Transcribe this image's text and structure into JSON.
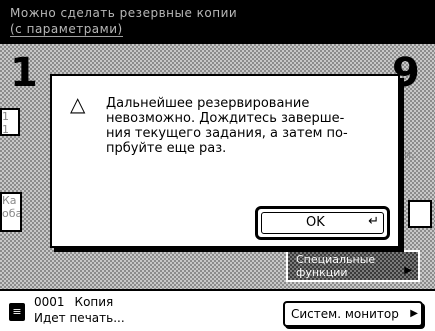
{
  "topbar": {
    "line1": "Можно сделать резервные копии",
    "line2": "(с параметрами)"
  },
  "background": {
    "big_number_left": "1",
    "big_number_right": "9",
    "left_btn_top": "1 1",
    "left_btn_mid": "Ка оба",
    "right_btn_top": "и.",
    "special_functions_line1": "Специальные",
    "special_functions_line2": "функции"
  },
  "dialog": {
    "icon": "warning-triangle-icon",
    "message": "Дальнейшее резервирование\nневозможно. Дождитесь заверше-\nния текущего задания, а затем по-\nпрбуйте еще раз.",
    "ok_label": "OK",
    "ok_icon": "enter-icon"
  },
  "statusbar": {
    "job_number": "0001",
    "job_type": "Копия",
    "job_status": "Идет печать...",
    "system_monitor_label": "Систем. монитор"
  }
}
